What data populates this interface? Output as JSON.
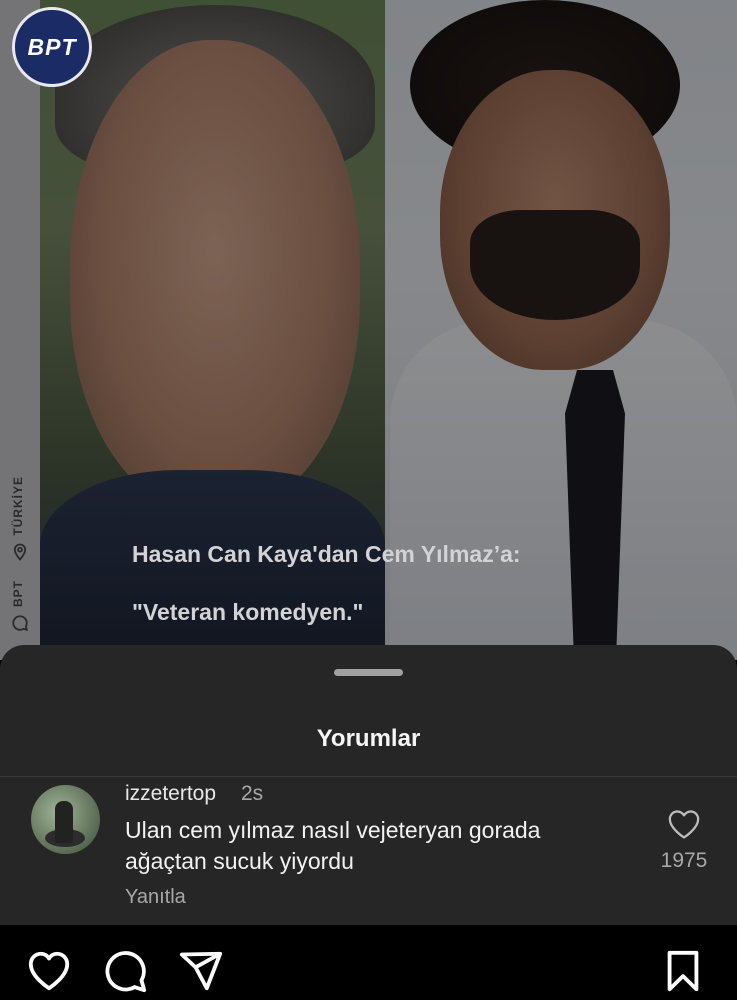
{
  "post": {
    "logo_text": "BPT",
    "side_labels": [
      "TÜRKİYE",
      "BPT"
    ],
    "caption_line1": "Hasan Can Kaya'dan Cem Yılmaz’a:",
    "caption_line2": "\"Veteran komedyen.\""
  },
  "comments_sheet": {
    "title": "Yorumlar",
    "comments": [
      {
        "username": "izzetertop",
        "time": "2s",
        "text": "Ulan cem yılmaz nasıl vejeteryan gorada ağaçtan sucuk yiyordu",
        "reply_label": "Yanıtla",
        "like_count": "1975"
      }
    ]
  },
  "bottom_bar": {
    "icons": [
      "heart-icon",
      "comment-icon",
      "share-icon",
      "bookmark-icon"
    ]
  },
  "colors": {
    "sheet_bg": "#262626",
    "bar_bg": "#000000",
    "muted_text": "#a8a8a8"
  }
}
